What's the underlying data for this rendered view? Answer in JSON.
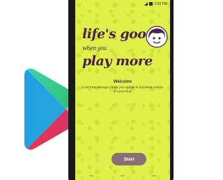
{
  "status_bar": {
    "time": "2:00 PM"
  },
  "slogan": {
    "line1_main": "life's good",
    "line1_small": "when you",
    "line2": "play more"
  },
  "welcome": {
    "title": "Welcome",
    "body": "CAM Plus Manager helps you update to the latest version of CAM Plus."
  },
  "start_button": {
    "label": "Start"
  },
  "icons": {
    "play_store": "google-play-logo-icon",
    "avatar": "girl-avatar-icon",
    "signal": "signal-icon",
    "battery": "battery-icon"
  },
  "colors": {
    "screen_bg": "#dff04a",
    "slogan_text": "#4a1f4a",
    "button_bg": "#8b6f76",
    "phone_frame": "#1a1a1a"
  }
}
